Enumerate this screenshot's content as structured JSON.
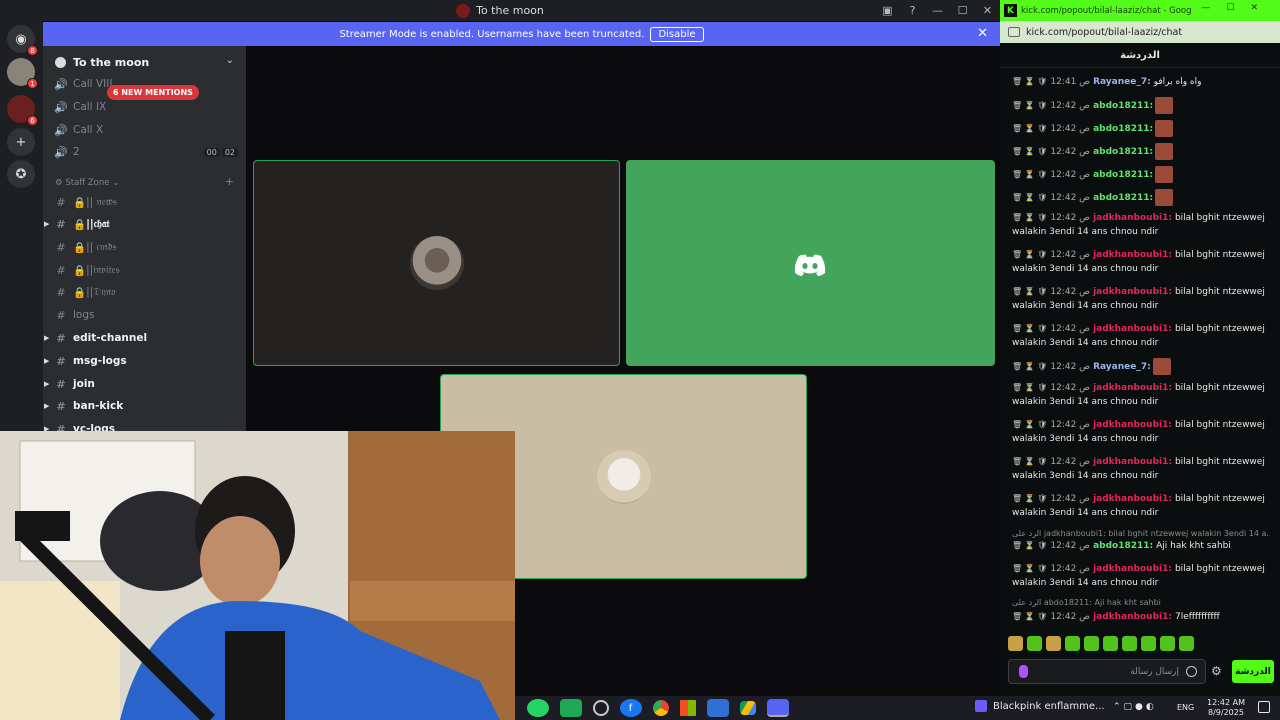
{
  "discord": {
    "window_title": "To the moon",
    "banner_text": "Streamer Mode is enabled. Usernames have been truncated.",
    "banner_button": "Disable",
    "server_name": "To the moon",
    "mentions_pill": "6 NEW MENTIONS",
    "voice_channels": [
      {
        "name": "Call VIII"
      },
      {
        "name": "Call IX"
      },
      {
        "name": "Call X"
      },
      {
        "name": "2",
        "counts": [
          "00",
          "02"
        ]
      }
    ],
    "category": "Staff Zone",
    "text_channels": [
      {
        "name": "|| 𝔫𝔢𝔴𝔰",
        "locked": true
      },
      {
        "name": "||𝔠𝔥𝔞𝔱",
        "locked": true
      },
      {
        "name": "|| 𝔠𝔪𝔡𝔰",
        "locked": true
      },
      {
        "name": "||𝔦𝔫𝔳𝔦𝔱𝔢𝔰",
        "locked": true
      },
      {
        "name": "||𝔇𝔶𝔫𝔬",
        "locked": true
      },
      {
        "name": "logs"
      },
      {
        "name": "edit-channel"
      },
      {
        "name": "msg-logs"
      },
      {
        "name": "join"
      },
      {
        "name": "ban-kick"
      },
      {
        "name": "vc-logs"
      }
    ],
    "guild_badges": [
      "8",
      "1",
      "6"
    ]
  },
  "browser": {
    "tab_title": "kick.com/popout/bilal-laaziz/chat - Google Chrome",
    "url": "kick.com/popout/bilal-laaziz/chat",
    "chat_header": "الدردشة",
    "messages": [
      {
        "time": "12:41 ص",
        "user": "Rayanee_7:",
        "color": "blue",
        "text": "واه واه برافو"
      },
      {
        "time": "12:42 ص",
        "user": "abdo18211:",
        "color": "green",
        "text": "",
        "emote": true
      },
      {
        "time": "12:42 ص",
        "user": "abdo18211:",
        "color": "green",
        "text": "",
        "emote": true
      },
      {
        "time": "12:42 ص",
        "user": "abdo18211:",
        "color": "green",
        "text": "",
        "emote": true
      },
      {
        "time": "12:42 ص",
        "user": "abdo18211:",
        "color": "green",
        "text": "",
        "emote": true
      },
      {
        "time": "12:42 ص",
        "user": "abdo18211:",
        "color": "green",
        "text": "",
        "emote": true
      },
      {
        "time": "12:42 ص",
        "user": "jadkhanboubi1:",
        "color": "pink",
        "text": "bilal bghit ntzewwej walakin 3endi 14 ans chnou ndir"
      },
      {
        "time": "12:42 ص",
        "user": "jadkhanboubi1:",
        "color": "pink",
        "text": "bilal bghit ntzewwej walakin 3endi 14 ans chnou ndir"
      },
      {
        "time": "12:42 ص",
        "user": "jadkhanboubi1:",
        "color": "pink",
        "text": "bilal bghit ntzewwej walakin 3endi 14 ans chnou ndir"
      },
      {
        "time": "12:42 ص",
        "user": "jadkhanboubi1:",
        "color": "pink",
        "text": "bilal bghit ntzewwej walakin 3endi 14 ans chnou ndir"
      },
      {
        "time": "12:42 ص",
        "user": "Rayanee_7:",
        "color": "blue",
        "text": "",
        "emote": true
      },
      {
        "time": "12:42 ص",
        "user": "jadkhanboubi1:",
        "color": "pink",
        "text": "bilal bghit ntzewwej walakin 3endi 14 ans chnou ndir"
      },
      {
        "time": "12:42 ص",
        "user": "jadkhanboubi1:",
        "color": "pink",
        "text": "bilal bghit ntzewwej walakin 3endi 14 ans chnou ndir"
      },
      {
        "time": "12:42 ص",
        "user": "jadkhanboubi1:",
        "color": "pink",
        "text": "bilal bghit ntzewwej walakin 3endi 14 ans chnou ndir"
      },
      {
        "time": "12:42 ص",
        "user": "jadkhanboubi1:",
        "color": "pink",
        "text": "bilal bghit ntzewwej walakin 3endi 14 ans chnou ndir"
      },
      {
        "reply": "الرد على jadkhanboubi1: bilal bghit ntzewwej walakin 3endi 14 a..."
      },
      {
        "time": "12:42 ص",
        "user": "abdo18211:",
        "color": "green",
        "text": "Aji hak kht sahbi"
      },
      {
        "time": "12:42 ص",
        "user": "jadkhanboubi1:",
        "color": "pink",
        "text": "bilal bghit ntzewwej walakin 3endi 14 ans chnou ndir"
      },
      {
        "reply": "الرد على abdo18211: Aji hak kht sahbi"
      },
      {
        "time": "12:42 ص",
        "user": "jadkhanboubi1:",
        "color": "pink",
        "text": "7leffffffffff"
      }
    ],
    "input_placeholder": "إرسال رسالة",
    "send_label": "الدردشة"
  },
  "taskbar": {
    "media_title": "Blackpink enflamme...",
    "lang": "ENG",
    "time": "12:42 AM",
    "date": "8/9/2025"
  },
  "colors": {
    "accent": "#53fc18",
    "blurple": "#5865f2",
    "speaking": "#23a559"
  }
}
